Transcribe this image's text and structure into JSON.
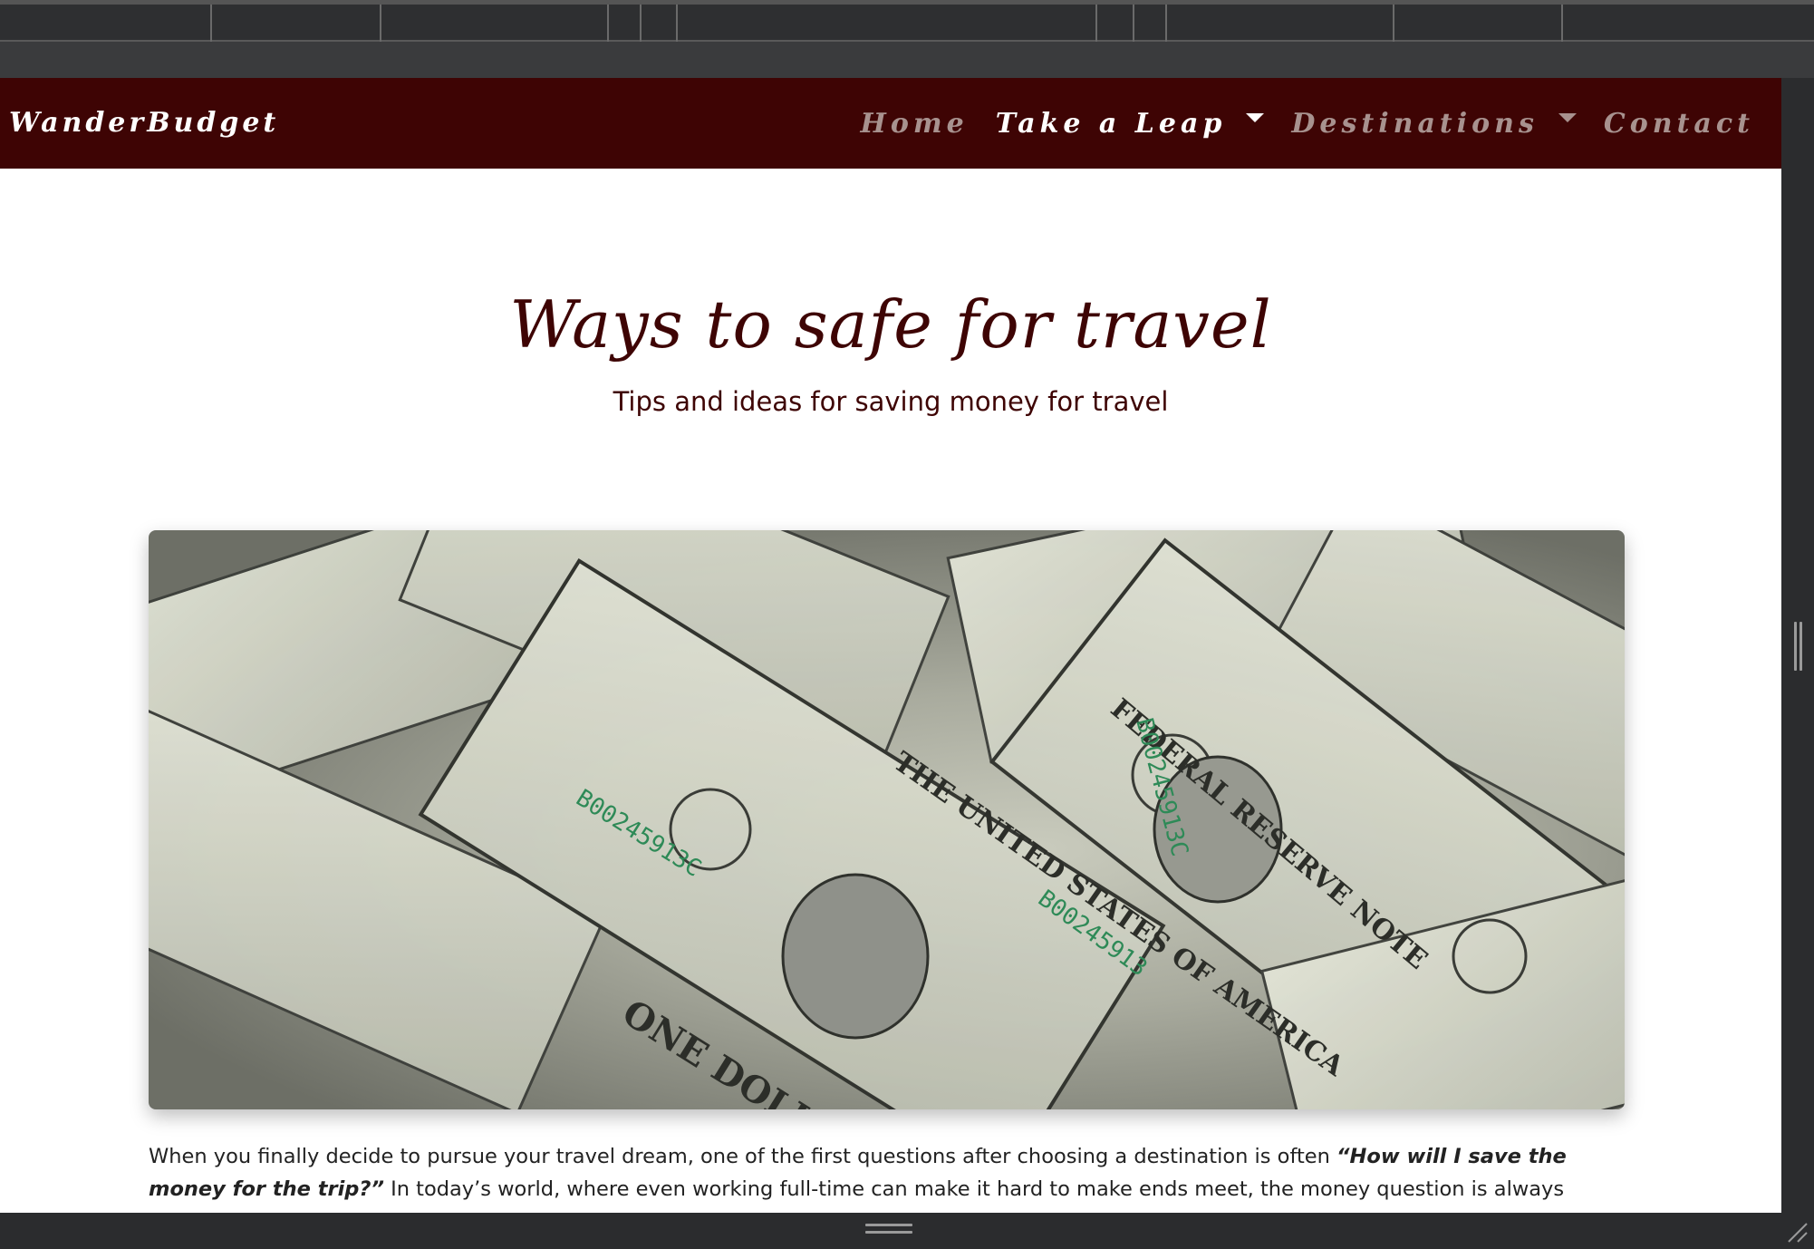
{
  "nav": {
    "brand": "WanderBudget",
    "items": [
      {
        "label": "Home",
        "active": false,
        "dropdown": false
      },
      {
        "label": "Take a Leap",
        "active": true,
        "dropdown": true
      },
      {
        "label": "Destinations",
        "active": false,
        "dropdown": true
      },
      {
        "label": "Contact",
        "active": false,
        "dropdown": false
      }
    ]
  },
  "hero": {
    "title": "Ways to safe for travel",
    "subtitle": "Tips and ideas for saving money for travel"
  },
  "image": {
    "subject": "pile of one dollar bills",
    "note_text": "THE UNITED STATES OF AMERICA",
    "serial": "B00245913C"
  },
  "intro": {
    "part1": "When you finally decide to pursue your travel dream, one of the first questions after choosing a destination is often ",
    "emphasis": "“How will I save the money for the trip?”",
    "part2": " In today’s world, where even working full-time can make it hard to make ends meet, the money question is always present. Luckily, there"
  },
  "colors": {
    "navbar_bg": "#3e0404",
    "title_color": "#3e0404",
    "nav_inactive": "#a8928f",
    "nav_active": "#ffffff",
    "chrome_bg": "#2b2c2e"
  },
  "icons": {
    "dropdown": "caret-down-icon",
    "resize": "resize-grip-icon"
  }
}
